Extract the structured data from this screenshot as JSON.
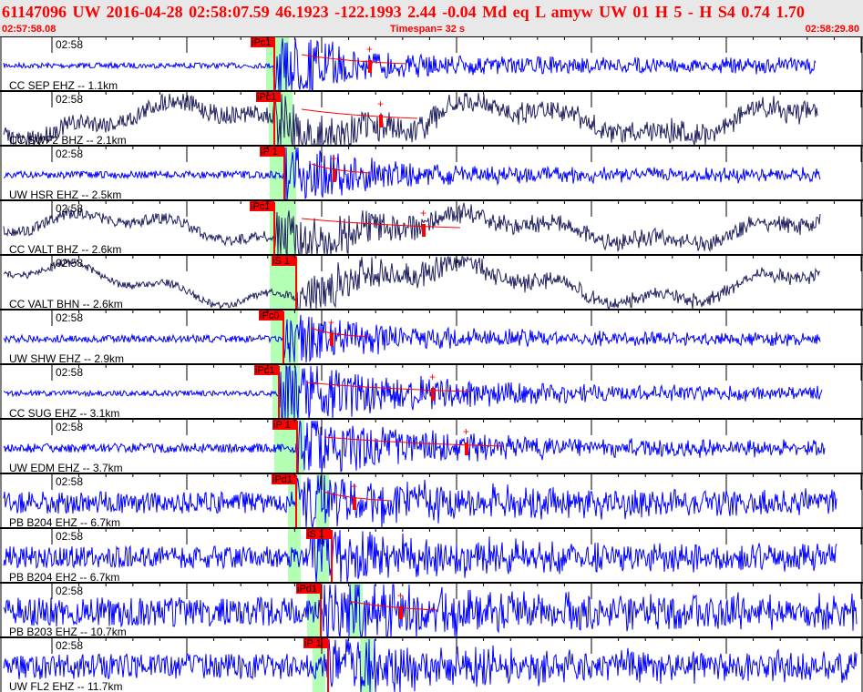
{
  "header": {
    "title": "61147096 UW 2016-04-28 02:58:07.59    46.1923 -122.1993    2.44 -0.04 Md   eq   L  amyw       UW 01   H    5   -   H S4     0.74   1.70",
    "start_time": "02:57:58.08",
    "timespan": "Timespan=  32 s",
    "end_time": "02:58:29.80"
  },
  "colors": {
    "short_period": "#0000ff",
    "broadband": "#202060",
    "pick": "#ff0000",
    "window": "#b3ffb3",
    "header_bg": "#e8e8e8"
  },
  "traces": [
    {
      "label": "CC SEP EHZ -- 1.1km",
      "time": "02:58",
      "pick": "iPc1",
      "type": "short_period"
    },
    {
      "label": "CC SWF2 BHZ -- 2.1km",
      "time": "02:58",
      "pick": "iPc1",
      "type": "broadband"
    },
    {
      "label": "UW HSR EHZ -- 2.5km",
      "time": "02:58",
      "pick": "iP 1",
      "type": "short_period"
    },
    {
      "label": "CC VALT BHZ -- 2.6km",
      "time": "02:58",
      "pick": "iPc1",
      "type": "broadband"
    },
    {
      "label": "CC VALT BHN -- 2.6km",
      "time": "02:58",
      "pick": "iS 1",
      "type": "broadband"
    },
    {
      "label": "UW SHW EHZ -- 2.9km",
      "time": "02:58",
      "pick": "iPc0",
      "type": "short_period"
    },
    {
      "label": "CC SUG EHZ -- 3.1km",
      "time": "02:58",
      "pick": "iPc1",
      "type": "short_period"
    },
    {
      "label": "UW EDM EHZ -- 3.7km",
      "time": "02:58",
      "pick": "iP 1",
      "type": "short_period"
    },
    {
      "label": "PB B204 EHZ -- 6.7km",
      "time": "02:58",
      "pick": "iPd1",
      "type": "short_period"
    },
    {
      "label": "PB B204 EH2 -- 6.7km",
      "time": "02:58",
      "pick": "iS 1",
      "type": "short_period"
    },
    {
      "label": "PB B203 EHZ -- 10.7km",
      "time": "02:58",
      "pick": "iPd1",
      "type": "short_period"
    },
    {
      "label": "UW FL2 EHZ -- 11.7km",
      "time": "02:58",
      "pick": "iP 1",
      "type": "short_period"
    }
  ]
}
